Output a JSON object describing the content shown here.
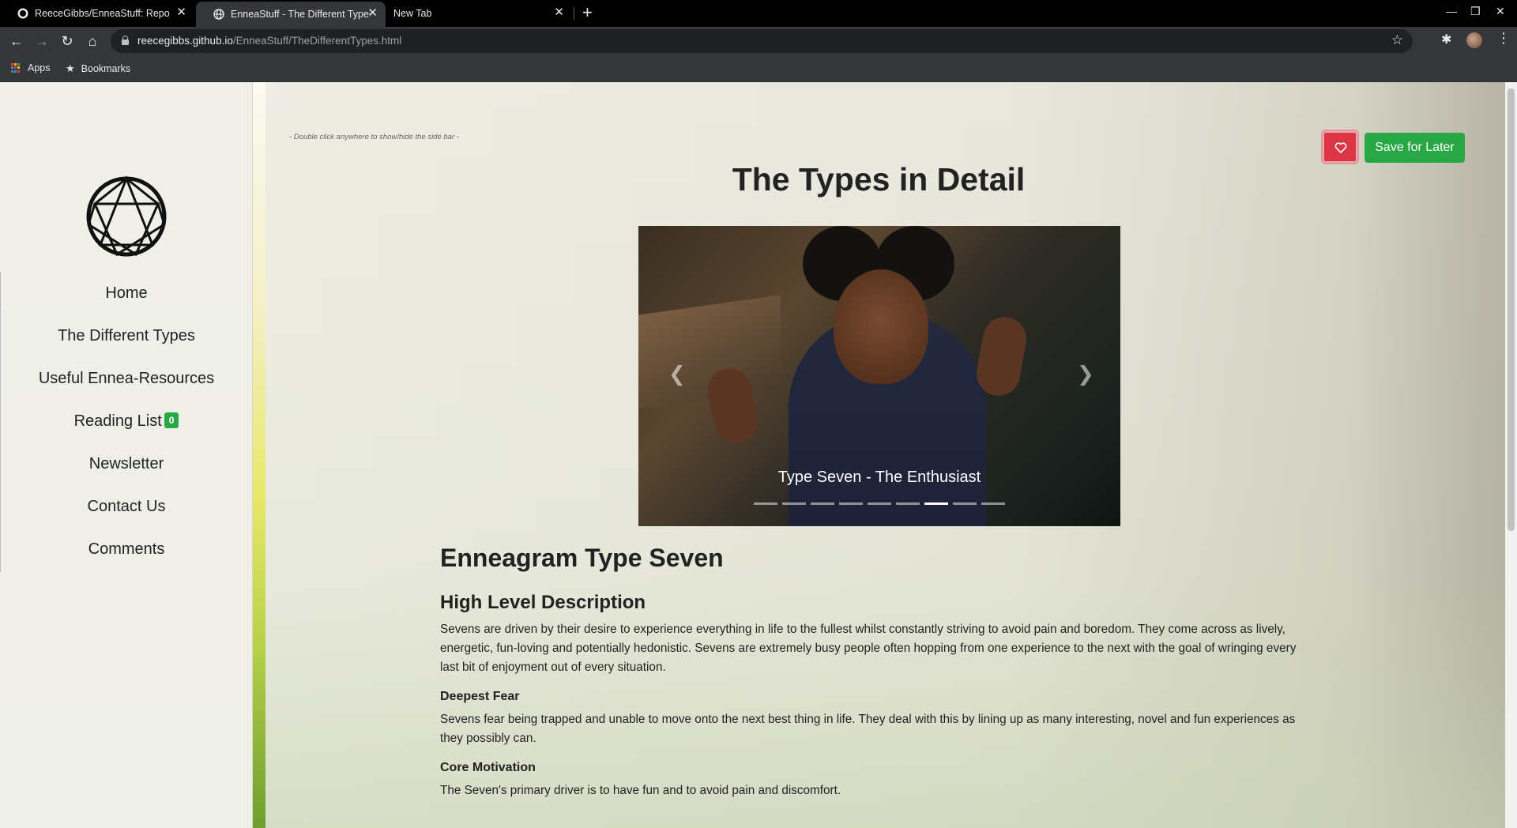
{
  "browser": {
    "tabs": [
      {
        "title": "ReeceGibbs/EnneaStuff: Repo",
        "active": false
      },
      {
        "title": "EnneaStuff - The Different Types",
        "active": true
      },
      {
        "title": "New Tab",
        "active": false
      }
    ],
    "url_host": "reecegibbs.github.io",
    "url_path": "/EnneaStuff/TheDifferentTypes.html",
    "bookmarks": {
      "apps": "Apps",
      "bookmarks": "Bookmarks"
    }
  },
  "sidebar": {
    "items": [
      {
        "label": "Home"
      },
      {
        "label": "The Different Types"
      },
      {
        "label": "Useful Ennea-Resources"
      },
      {
        "label": "Reading List",
        "badge": "0"
      },
      {
        "label": "Newsletter"
      },
      {
        "label": "Contact Us"
      },
      {
        "label": "Comments"
      }
    ]
  },
  "main": {
    "hint": "- Double click anywhere to show/hide the side bar -",
    "save_label": "Save for Later",
    "title": "The Types in Detail",
    "carousel": {
      "caption": "Type Seven - The Enthusiast",
      "slide_count": 9,
      "active_index": 6
    },
    "section_title": "Enneagram Type Seven",
    "high_level_title": "High Level Description",
    "high_level_text": "Sevens are driven by their desire to experience everything in life to the fullest whilst constantly striving to avoid pain and boredom. They come across as lively, energetic, fun-loving and potentially hedonistic. Sevens are extremely busy people often hopping from one experience to the next with the goal of wringing every last bit of enjoyment out of every situation.",
    "fear_title": "Deepest Fear",
    "fear_text": "Sevens fear being trapped and unable to move onto the next best thing in life. They deal with this by lining up as many interesting, novel and fun experiences as they possibly can.",
    "motivation_title": "Core Motivation",
    "motivation_text": "The Seven's primary driver is to have fun and to avoid pain and discomfort."
  },
  "colors": {
    "accent_green": "#28a745",
    "heart_red": "#dc3545"
  }
}
